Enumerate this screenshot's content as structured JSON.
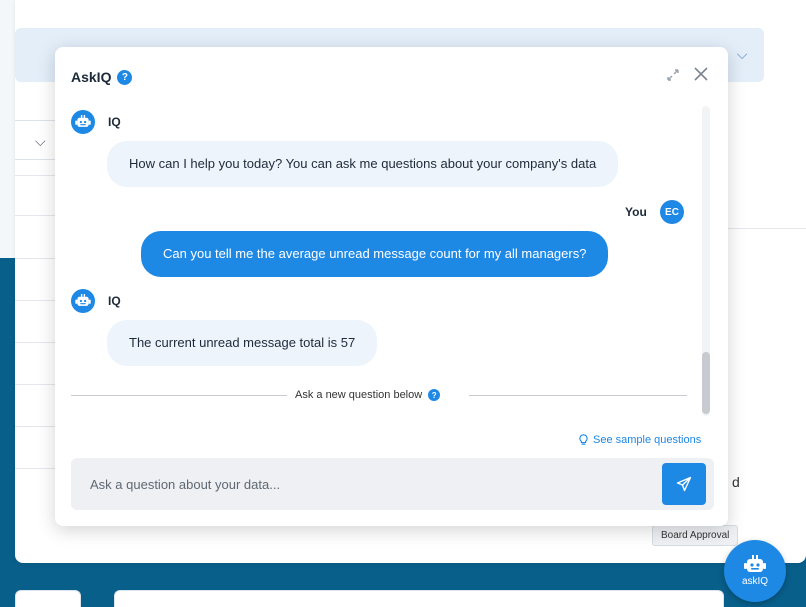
{
  "dialog": {
    "title": "AskIQ",
    "help_glyph": "?",
    "expand_icon": "expand-icon",
    "close_icon": "close-icon"
  },
  "messages": [
    {
      "sender": "IQ",
      "role": "bot",
      "text": "How can I help you today? You can ask me questions about your company's data"
    },
    {
      "sender": "You",
      "role": "user",
      "initials": "EC",
      "text": "Can you tell me the average unread message count for my all managers?"
    },
    {
      "sender": "IQ",
      "role": "bot",
      "text": "The current unread message total is 57"
    }
  ],
  "divider": {
    "text": "Ask a new question below"
  },
  "sample_questions": {
    "label": "See sample questions",
    "icon": "lightbulb-icon"
  },
  "input": {
    "placeholder": "Ask a question about your data...",
    "value": ""
  },
  "send_button": {
    "icon": "send-icon"
  },
  "background": {
    "right_letter": "d",
    "tooltip": "Board Approval",
    "fab_label": "askIQ"
  },
  "colors": {
    "accent": "#1e88e5",
    "bot_bubble": "#eef4fb",
    "backdrop": "#085f8a"
  }
}
